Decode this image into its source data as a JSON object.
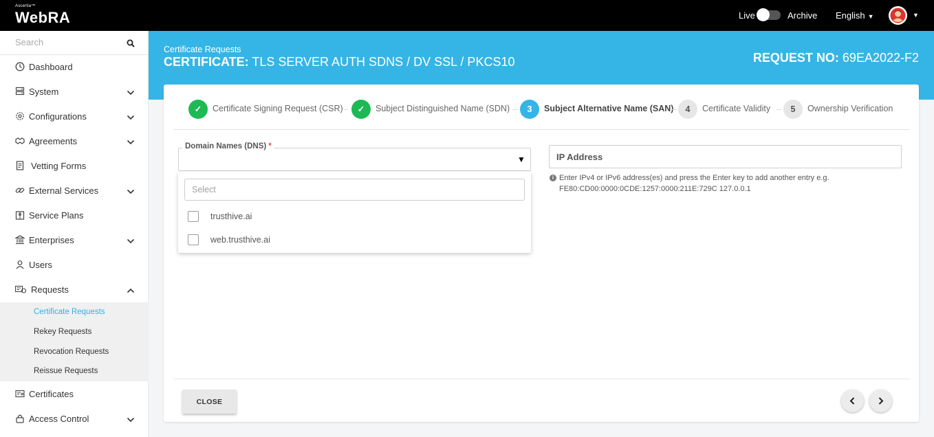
{
  "app": {
    "logo_small": "Ascertia™",
    "logo_name": "WebRA",
    "live_label": "Live",
    "archive_label": "Archive",
    "language": "English"
  },
  "sidebar": {
    "search_placeholder": "Search",
    "items": [
      {
        "label": "Dashboard",
        "icon": "clock-icon",
        "has_chevron": false
      },
      {
        "label": "System",
        "icon": "server-icon",
        "has_chevron": true
      },
      {
        "label": "Configurations",
        "icon": "gear-icon",
        "has_chevron": true
      },
      {
        "label": "Agreements",
        "icon": "handshake-icon",
        "has_chevron": true
      },
      {
        "label": "Vetting Forms",
        "icon": "form-icon",
        "has_chevron": false
      },
      {
        "label": "External Services",
        "icon": "link-icon",
        "has_chevron": true
      },
      {
        "label": "Service Plans",
        "icon": "plans-icon",
        "has_chevron": false
      },
      {
        "label": "Enterprises",
        "icon": "bank-icon",
        "has_chevron": true
      },
      {
        "label": "Users",
        "icon": "user-icon",
        "has_chevron": false
      },
      {
        "label": "Requests",
        "icon": "requests-icon",
        "has_chevron": true,
        "expanded": true
      },
      {
        "label": "Certificates",
        "icon": "certificate-icon",
        "has_chevron": false
      },
      {
        "label": "Access Control",
        "icon": "lock-icon",
        "has_chevron": true
      }
    ],
    "sub_items": [
      {
        "label": "Certificate Requests",
        "active": true
      },
      {
        "label": "Rekey Requests",
        "active": false
      },
      {
        "label": "Revocation Requests",
        "active": false
      },
      {
        "label": "Reissue Requests",
        "active": false
      }
    ]
  },
  "banner": {
    "breadcrumb": "Certificate Requests",
    "title_prefix": "CERTIFICATE:",
    "title_value": "TLS SERVER AUTH SDNS / DV SSL / PKCS10",
    "request_prefix": "REQUEST NO:",
    "request_value": "69EA2022-F2"
  },
  "steps": [
    {
      "marker": "✓",
      "label": "Certificate Signing Request (CSR)",
      "state": "done"
    },
    {
      "marker": "✓",
      "label": "Subject Distinguished Name (SDN)",
      "state": "done"
    },
    {
      "marker": "3",
      "label": "Subject Alternative Name (SAN)",
      "state": "active"
    },
    {
      "marker": "4",
      "label": "Certificate Validity",
      "state": "todo"
    },
    {
      "marker": "5",
      "label": "Ownership Verification",
      "state": "todo"
    }
  ],
  "form": {
    "dns_label": "Domain Names (DNS)",
    "dns_required_mark": "*",
    "dropdown_search_placeholder": "Select",
    "dns_options": [
      "trusthive.ai",
      "web.trusthive.ai"
    ],
    "ip_placeholder": "IP Address",
    "ip_hint_line1": "Enter IPv4 or IPv6 address(es) and press the Enter key to add another entry e.g.",
    "ip_hint_line2": "FE80:CD00:0000:0CDE:1257:0000:211E:729C 127.0.0.1"
  },
  "footer": {
    "close_label": "CLOSE"
  },
  "colors": {
    "accent": "#35b5e5",
    "success": "#1db954",
    "topbar": "#000000",
    "required": "#d9534f"
  }
}
